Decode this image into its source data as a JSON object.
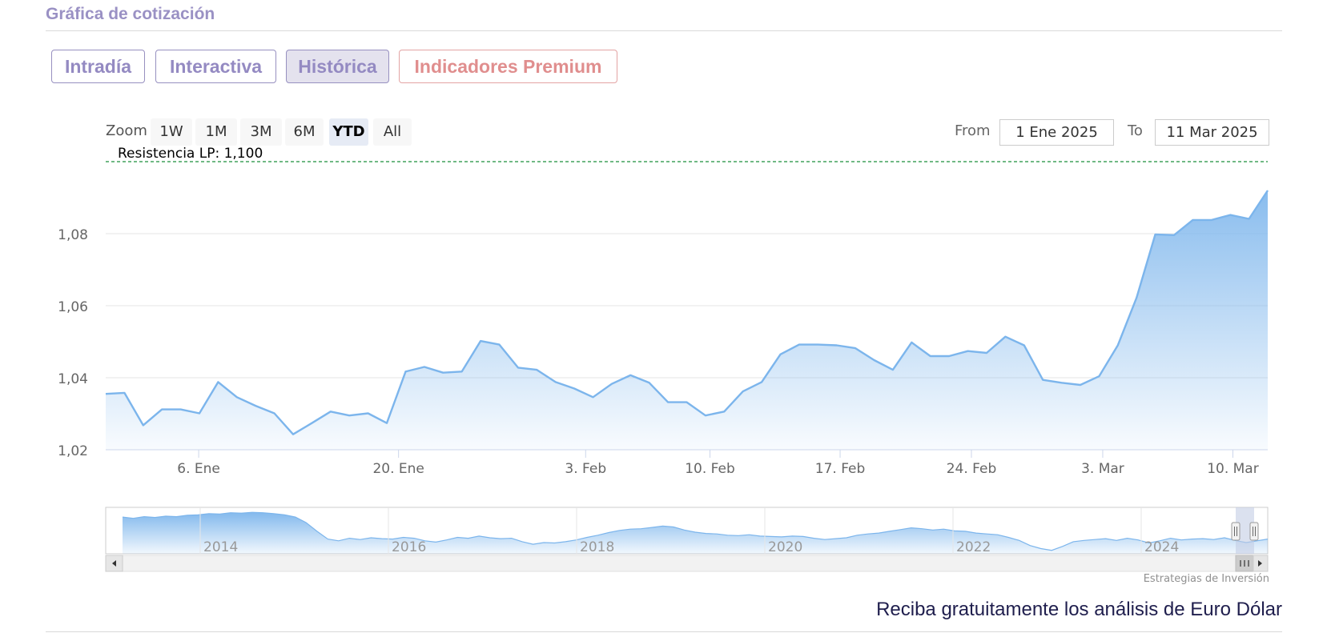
{
  "section": {
    "title": "Gráfica de cotización"
  },
  "tabs": [
    {
      "label": "Intradía",
      "active": false
    },
    {
      "label": "Interactiva",
      "active": false
    },
    {
      "label": "Histórica",
      "active": true
    },
    {
      "label": "Indicadores Premium",
      "active": false
    }
  ],
  "toolbar": {
    "zoom_label": "Zoom",
    "zoom_buttons": [
      "1W",
      "1M",
      "3M",
      "6M",
      "YTD",
      "All"
    ],
    "zoom_selected": "YTD",
    "from_label": "From",
    "from_value": "1 Ene 2025",
    "to_label": "To",
    "to_value": "11 Mar 2025"
  },
  "chart_data": {
    "type": "area",
    "title": "",
    "xlabel": "",
    "ylabel": "",
    "x_tick_labels": [
      "6. Ene",
      "20. Ene",
      "3. Feb",
      "10. Feb",
      "17. Feb",
      "24. Feb",
      "3. Mar",
      "10. Mar"
    ],
    "y_tick_labels": [
      "1,02",
      "1,04",
      "1,06",
      "1,08"
    ],
    "ylim": [
      1.02,
      1.1
    ],
    "grid": true,
    "series": [
      {
        "values": [
          [
            "2025-01-01",
            1.0355
          ],
          [
            "2025-01-02",
            1.0358
          ],
          [
            "2025-01-03",
            1.0268
          ],
          [
            "2025-01-04",
            1.0312
          ],
          [
            "2025-01-05",
            1.0312
          ],
          [
            "2025-01-06",
            1.0301
          ],
          [
            "2025-01-07",
            1.0388
          ],
          [
            "2025-01-08",
            1.0346
          ],
          [
            "2025-01-09",
            1.0322
          ],
          [
            "2025-01-10",
            1.0301
          ],
          [
            "2025-01-11",
            1.0243
          ],
          [
            "2025-01-12",
            1.0274
          ],
          [
            "2025-01-13",
            1.0306
          ],
          [
            "2025-01-14",
            1.0295
          ],
          [
            "2025-01-15",
            1.0301
          ],
          [
            "2025-01-16",
            1.0274
          ],
          [
            "2025-01-17",
            1.0417
          ],
          [
            "2025-01-18",
            1.043
          ],
          [
            "2025-01-19",
            1.0414
          ],
          [
            "2025-01-20",
            1.0417
          ],
          [
            "2025-01-21",
            1.0502
          ],
          [
            "2025-01-22",
            1.0492
          ],
          [
            "2025-01-23",
            1.0428
          ],
          [
            "2025-01-24",
            1.0422
          ],
          [
            "2025-01-25",
            1.0388
          ],
          [
            "2025-01-26",
            1.037
          ],
          [
            "2025-01-27",
            1.0346
          ],
          [
            "2025-01-28",
            1.0383
          ],
          [
            "2025-01-29",
            1.0407
          ],
          [
            "2025-01-30",
            1.0386
          ],
          [
            "2025-01-31",
            1.0332
          ],
          [
            "2025-02-01",
            1.0332
          ],
          [
            "2025-02-02",
            1.0295
          ],
          [
            "2025-02-03",
            1.0306
          ],
          [
            "2025-02-04",
            1.0362
          ],
          [
            "2025-02-05",
            1.0388
          ],
          [
            "2025-02-06",
            1.0465
          ],
          [
            "2025-02-07",
            1.0492
          ],
          [
            "2025-02-08",
            1.0492
          ],
          [
            "2025-02-09",
            1.049
          ],
          [
            "2025-02-10",
            1.0482
          ],
          [
            "2025-02-11",
            1.0449
          ],
          [
            "2025-02-12",
            1.0422
          ],
          [
            "2025-02-13",
            1.0498
          ],
          [
            "2025-02-14",
            1.046
          ],
          [
            "2025-02-15",
            1.046
          ],
          [
            "2025-02-16",
            1.0474
          ],
          [
            "2025-02-17",
            1.0469
          ],
          [
            "2025-02-18",
            1.0514
          ],
          [
            "2025-02-19",
            1.049
          ],
          [
            "2025-02-20",
            1.0394
          ],
          [
            "2025-02-21",
            1.0386
          ],
          [
            "2025-02-22",
            1.038
          ],
          [
            "2025-02-23",
            1.0404
          ],
          [
            "2025-02-24",
            1.049
          ],
          [
            "2025-02-25",
            1.0622
          ],
          [
            "2025-02-26",
            1.0798
          ],
          [
            "2025-02-27",
            1.0796
          ],
          [
            "2025-02-28",
            1.0838
          ],
          [
            "2025-03-01",
            1.0838
          ],
          [
            "2025-03-02",
            1.0852
          ],
          [
            "2025-03-03",
            1.0841
          ],
          [
            "2025-03-04",
            1.092
          ]
        ]
      }
    ],
    "plot_lines": [
      {
        "label": "Resistencia LP: 1,100",
        "value": 1.1,
        "style": "dashed",
        "color": "#1a8f3a"
      }
    ],
    "colors": {
      "line": "#7cb5ec",
      "fill": "#7cb5ec",
      "grid": "#e6e6e6",
      "navigator_mask": "#c3cde4"
    },
    "navigator": {
      "year_labels": [
        "2014",
        "2016",
        "2018",
        "2020",
        "2022",
        "2024"
      ],
      "values": [
        0.85,
        0.82,
        0.86,
        0.84,
        0.87,
        0.86,
        0.89,
        0.9,
        0.93,
        0.92,
        0.95,
        0.94,
        0.96,
        0.95,
        0.93,
        0.9,
        0.85,
        0.72,
        0.52,
        0.34,
        0.3,
        0.36,
        0.33,
        0.37,
        0.35,
        0.34,
        0.38,
        0.36,
        0.3,
        0.27,
        0.32,
        0.38,
        0.36,
        0.41,
        0.37,
        0.35,
        0.36,
        0.28,
        0.22,
        0.26,
        0.25,
        0.28,
        0.32,
        0.38,
        0.43,
        0.49,
        0.54,
        0.57,
        0.58,
        0.61,
        0.64,
        0.62,
        0.55,
        0.5,
        0.47,
        0.46,
        0.43,
        0.42,
        0.44,
        0.41,
        0.4,
        0.39,
        0.41,
        0.4,
        0.36,
        0.33,
        0.35,
        0.37,
        0.43,
        0.46,
        0.48,
        0.52,
        0.56,
        0.6,
        0.58,
        0.55,
        0.57,
        0.53,
        0.52,
        0.48,
        0.46,
        0.44,
        0.38,
        0.31,
        0.19,
        0.12,
        0.08,
        0.17,
        0.28,
        0.31,
        0.33,
        0.35,
        0.31,
        0.36,
        0.32,
        0.25,
        0.3,
        0.36,
        0.32,
        0.34,
        0.35,
        0.33,
        0.37,
        0.31,
        0.26,
        0.3,
        0.34
      ]
    }
  },
  "credit": "Estrategias de Inversión",
  "cta": "Reciba gratuitamente los análisis de Euro Dólar"
}
